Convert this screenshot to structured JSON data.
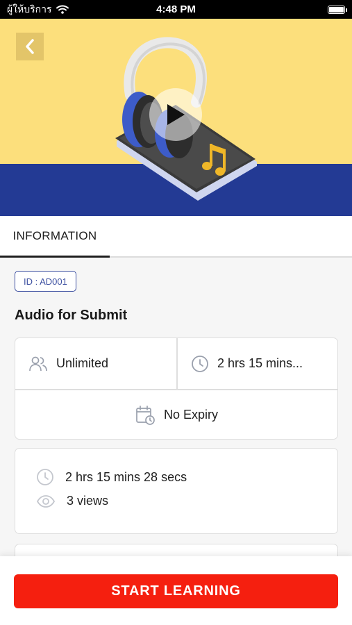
{
  "status_bar": {
    "carrier": "ผู้ให้บริการ",
    "time": "4:48 PM"
  },
  "hero": {
    "colors": {
      "top": "#fcdf7c",
      "band": "#233a94"
    }
  },
  "tabs": [
    {
      "label": "INFORMATION",
      "active": true
    }
  ],
  "content": {
    "id_badge": "ID : AD001",
    "title": "Audio for Submit",
    "info": {
      "seats": "Unlimited",
      "duration_short": "2 hrs 15 mins...",
      "expiry": "No Expiry"
    },
    "stats": {
      "duration": "2 hrs 15 mins 28 secs",
      "views": "3 views"
    }
  },
  "actions": {
    "start_label": "START LEARNING",
    "start_color": "#f51f0f"
  }
}
